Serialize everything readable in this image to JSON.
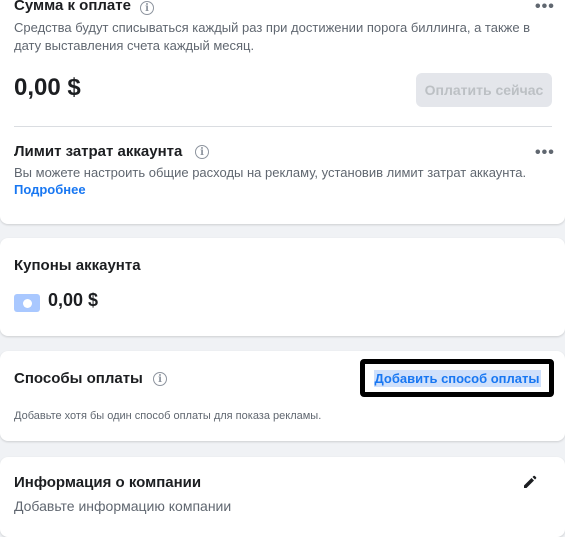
{
  "payment_due": {
    "title": "Сумма к оплате",
    "description_line1": "Средства будут списываться каждый раз при достижении порога биллинга, а также в",
    "description_line2": "дату выставления счета каждый месяц.",
    "amount": "0,00 $",
    "pay_now_button": "Оплатить сейчас",
    "more_icon": "more-horizontal-icon",
    "info_icon": "info-icon"
  },
  "spending_limit": {
    "title": "Лимит затрат аккаунта",
    "description": "Вы можете настроить общие расходы на рекламу, установив лимит затрат аккаунта.",
    "learn_more": "Подробнее"
  },
  "coupons": {
    "title": "Купоны аккаунта",
    "amount": "0,00 $",
    "icon": "coupon-icon"
  },
  "payment_methods": {
    "title": "Способы оплаты",
    "add_button": "Добавить способ оплаты",
    "description": "Добавьте хотя бы один способ оплаты для показа рекламы."
  },
  "company_info": {
    "title": "Информация о компании",
    "description": "Добавьте информацию компании",
    "edit_icon": "pencil-icon"
  },
  "colors": {
    "link": "#1877f2",
    "background": "#f0f2f5",
    "disabled_button": "#e4e6eb"
  }
}
